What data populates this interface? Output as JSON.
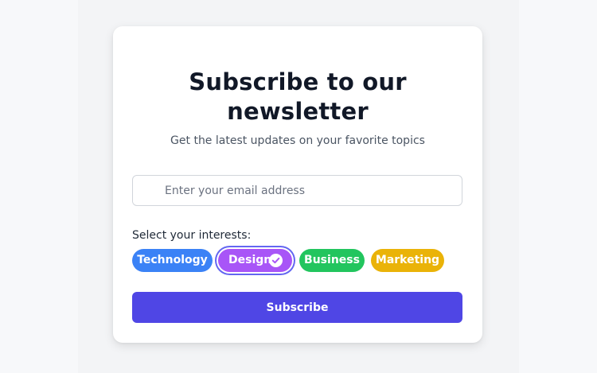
{
  "newsletter": {
    "title": "Subscribe to our newsletter",
    "subtitle": "Get the latest updates on your favorite topics",
    "email": {
      "value": "",
      "placeholder": "Enter your email address",
      "icon": "mail-icon"
    },
    "interests_label": "Select your interests:",
    "tags": [
      {
        "label": "Technology",
        "color": "#3b82f6",
        "selected": false
      },
      {
        "label": "Design",
        "color": "#a855f7",
        "selected": true,
        "icon": "check-circle-icon"
      },
      {
        "label": "Business",
        "color": "#22c55e",
        "selected": false
      },
      {
        "label": "Marketing",
        "color": "#eab308",
        "selected": false
      }
    ],
    "subscribe_label": "Subscribe",
    "colors": {
      "accent": "#4f46e5",
      "selected_ring": "#6366f1",
      "background": "#f3f4f6",
      "card": "#ffffff",
      "title": "#111827"
    }
  }
}
